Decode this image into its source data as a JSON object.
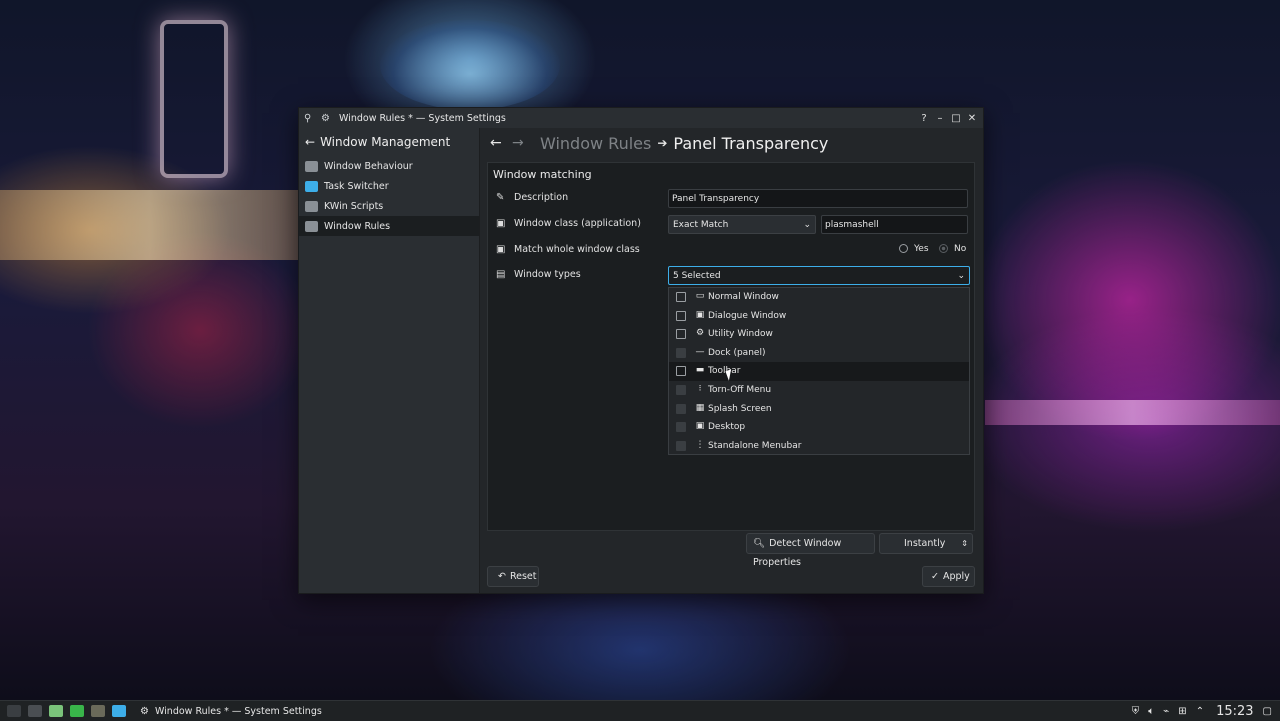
{
  "window": {
    "title": "Window Rules * — System Settings",
    "controls": [
      "?",
      "–",
      "□",
      "✕"
    ]
  },
  "sidebar": {
    "back_label": "Window Management",
    "items": [
      {
        "label": "Window Behaviour",
        "icon": "window-behaviour-icon"
      },
      {
        "label": "Task Switcher",
        "icon": "task-switcher-icon"
      },
      {
        "label": "KWin Scripts",
        "icon": "kwin-scripts-icon"
      },
      {
        "label": "Window Rules",
        "icon": "window-rules-icon",
        "active": true
      }
    ]
  },
  "breadcrumb": {
    "parent": "Window Rules",
    "separator": "➔",
    "current": "Panel Transparency"
  },
  "matching": {
    "title": "Window matching",
    "description_label": "Description",
    "description_value": "Panel Transparency",
    "class_label": "Window class (application)",
    "class_match": "Exact Match",
    "class_value": "plasmashell",
    "whole_class_label": "Match whole window class",
    "yes_label": "Yes",
    "no_label": "No",
    "types_label": "Window types",
    "types_value": "5 Selected"
  },
  "window_types": [
    {
      "label": "Normal Window",
      "icon": "normal-window-icon",
      "checked": false
    },
    {
      "label": "Dialogue Window",
      "icon": "dialogue-window-icon",
      "checked": false
    },
    {
      "label": "Utility Window",
      "icon": "utility-window-icon",
      "checked": false
    },
    {
      "label": "Dock (panel)",
      "icon": "dock-icon",
      "checked": true
    },
    {
      "label": "Toolbar",
      "icon": "toolbar-icon",
      "checked": false,
      "hover": true
    },
    {
      "label": "Torn-Off Menu",
      "icon": "torn-off-menu-icon",
      "checked": true
    },
    {
      "label": "Splash Screen",
      "icon": "splash-screen-icon",
      "checked": true
    },
    {
      "label": "Desktop",
      "icon": "desktop-icon",
      "checked": true
    },
    {
      "label": "Standalone Menubar",
      "icon": "menubar-icon",
      "checked": true
    }
  ],
  "actions": {
    "detect_label": "Detect Window Properties",
    "delay_value": "Instantly",
    "reset_label": "Reset",
    "apply_label": "Apply"
  },
  "taskbar": {
    "task_label": "Window Rules * — System Settings",
    "clock": "15:23"
  },
  "colors": {
    "window_bg": "#232629",
    "panel_bg": "#1b1e20",
    "accent": "#3daee9"
  }
}
